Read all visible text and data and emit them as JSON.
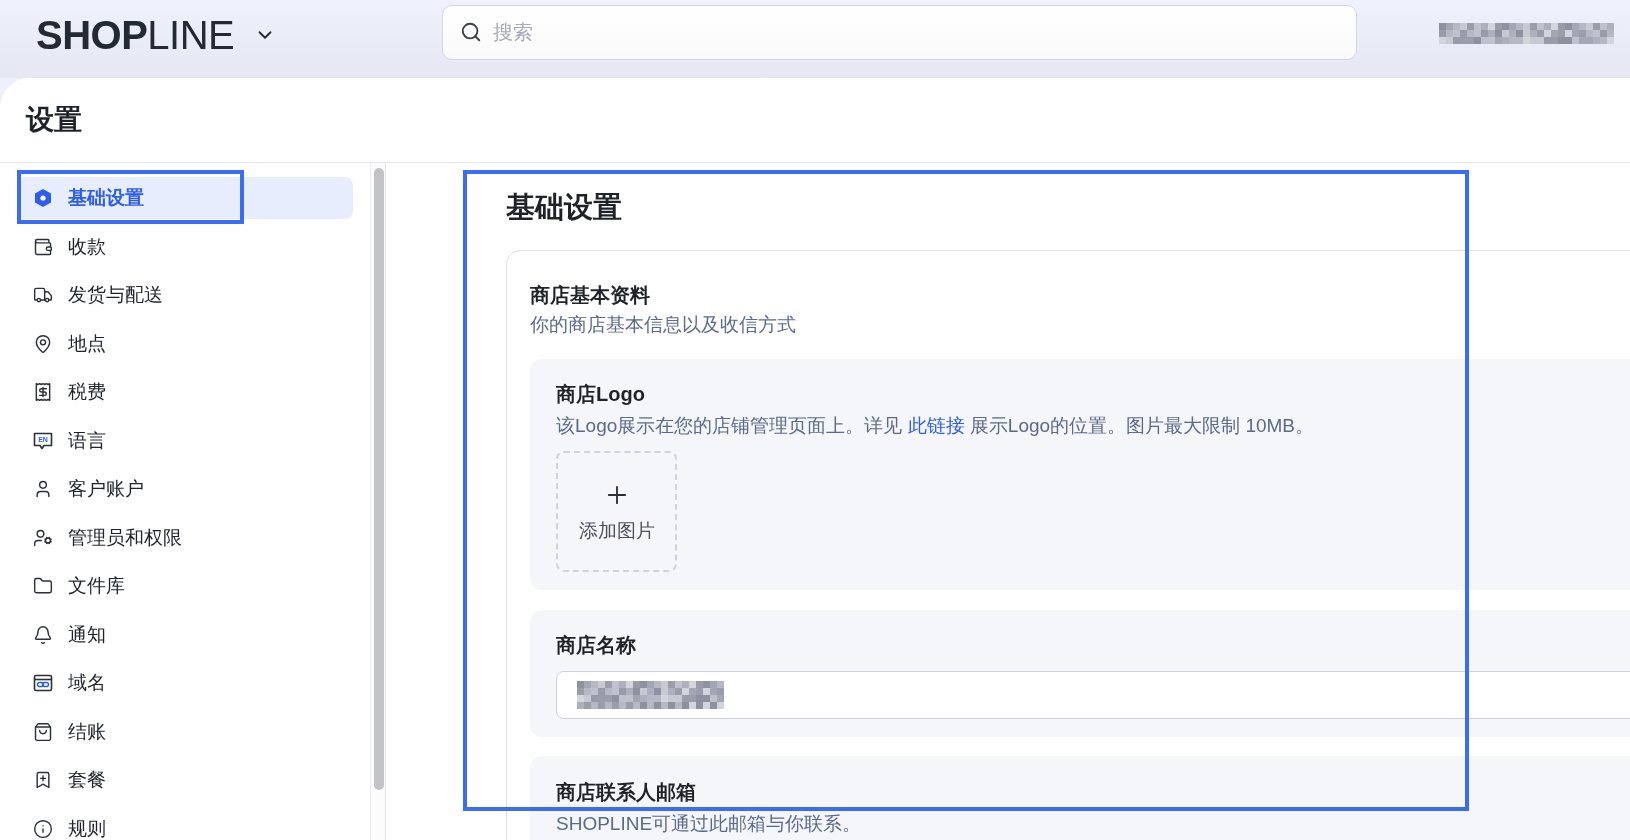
{
  "header": {
    "logo": "**SHOP**LINE",
    "search": {
      "placeholder": "搜索"
    }
  },
  "page": {
    "title": "设置"
  },
  "sidebar": {
    "items": [
      {
        "label": "基础设置",
        "selected": true,
        "highlighted": true
      },
      {
        "label": "收款",
        "selected": false,
        "highlighted": false
      },
      {
        "label": "发货与配送",
        "selected": false,
        "highlighted": false
      },
      {
        "label": "地点",
        "selected": false,
        "highlighted": false
      },
      {
        "label": "税费",
        "selected": false,
        "highlighted": false
      },
      {
        "label": "语言",
        "selected": false,
        "highlighted": false,
        "icon_text": "EN"
      },
      {
        "label": "客户账户",
        "selected": false,
        "highlighted": false
      },
      {
        "label": "管理员和权限",
        "selected": false,
        "highlighted": false
      },
      {
        "label": "文件库",
        "selected": false,
        "highlighted": false
      },
      {
        "label": "通知",
        "selected": false,
        "highlighted": false
      },
      {
        "label": "域名",
        "selected": false,
        "highlighted": false
      },
      {
        "label": "结账",
        "selected": false,
        "highlighted": false
      },
      {
        "label": "套餐",
        "selected": false,
        "highlighted": false
      },
      {
        "label": "规则",
        "selected": false,
        "highlighted": false
      }
    ]
  },
  "content": {
    "title": "基础设置",
    "highlighted": true,
    "card": {
      "title": "商店基本资料",
      "subtitle": "你的商店基本信息以及收信方式",
      "sections": [
        {
          "kind": "upload",
          "title": "商店Logo",
          "description": "该Logo展示在您的店铺管理页面上。详见",
          "link": "此链接",
          "description_after": "展示Logo的位置。图片最大限制 10MB。",
          "upload_label": "添加图片"
        },
        {
          "kind": "text_field",
          "title": "商店名称"
        },
        {
          "kind": "text",
          "title": "商店联系人邮箱",
          "description": "SHOPLINE可通过此邮箱与你联系。"
        }
      ]
    }
  }
}
